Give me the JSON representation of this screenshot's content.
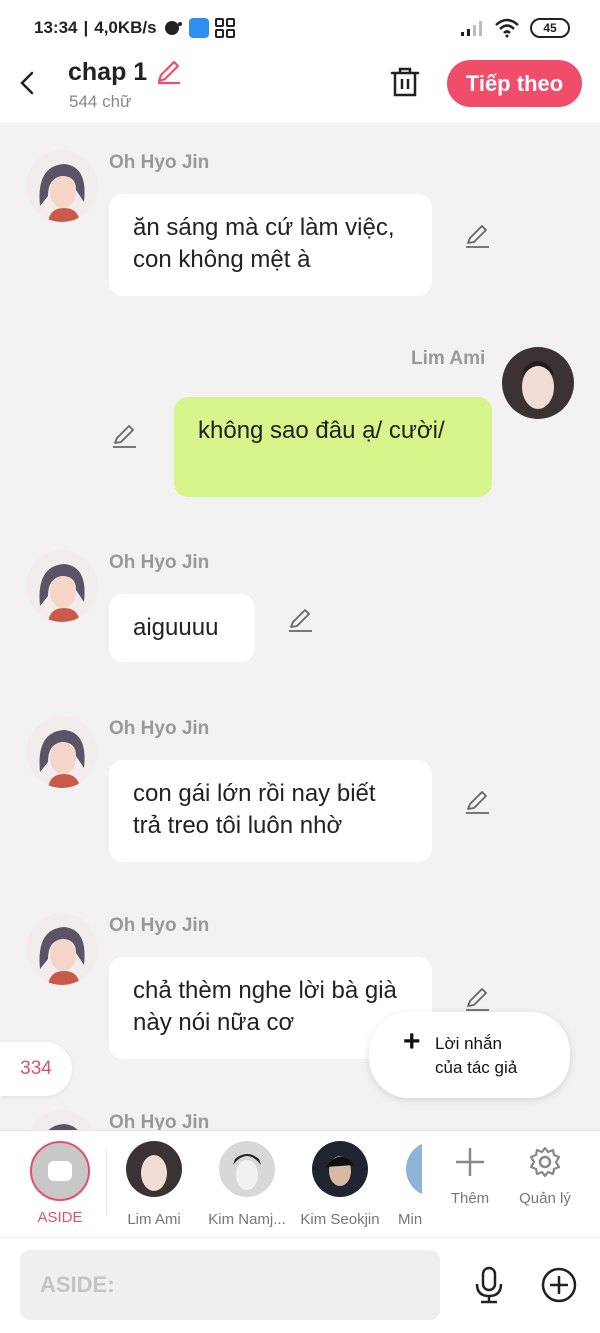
{
  "status_bar": {
    "time": "13:34",
    "speed": "4,0KB/s",
    "battery": "45"
  },
  "header": {
    "title": "chap 1",
    "subtitle": "544 chữ",
    "next_label": "Tiếp theo"
  },
  "messages": [
    {
      "sender": "Oh Hyo Jin",
      "text": "ăn sáng mà cứ làm việc, con không mệt à"
    },
    {
      "sender": "Lim Ami",
      "text": "không sao đâu ạ/ cười/"
    },
    {
      "sender": "Oh Hyo Jin",
      "text": "aiguuuu"
    },
    {
      "sender": "Oh Hyo Jin",
      "text": "con gái lớn rồi nay biết trả treo tôi luôn nhờ"
    },
    {
      "sender": "Oh Hyo Jin",
      "text": "chả thèm nghe lời bà già này nói nữa cơ"
    },
    {
      "sender": "Oh Hyo Jin",
      "text": ""
    }
  ],
  "count_badge": "334",
  "author_note": {
    "line1": "Lời nhắn",
    "line2": "của tác giả"
  },
  "characters": {
    "aside": "ASIDE",
    "items": [
      {
        "name": "Lim Ami"
      },
      {
        "name": "Kim Namj..."
      },
      {
        "name": "Kim Seokjin"
      },
      {
        "name": "Min"
      }
    ],
    "add_label": "Thêm",
    "manage_label": "Quản lý"
  },
  "input": {
    "placeholder": "ASIDE:"
  },
  "colors": {
    "accent": "#f04d6a",
    "my_bubble": "#d7f58a",
    "background": "#f2f2f2"
  }
}
